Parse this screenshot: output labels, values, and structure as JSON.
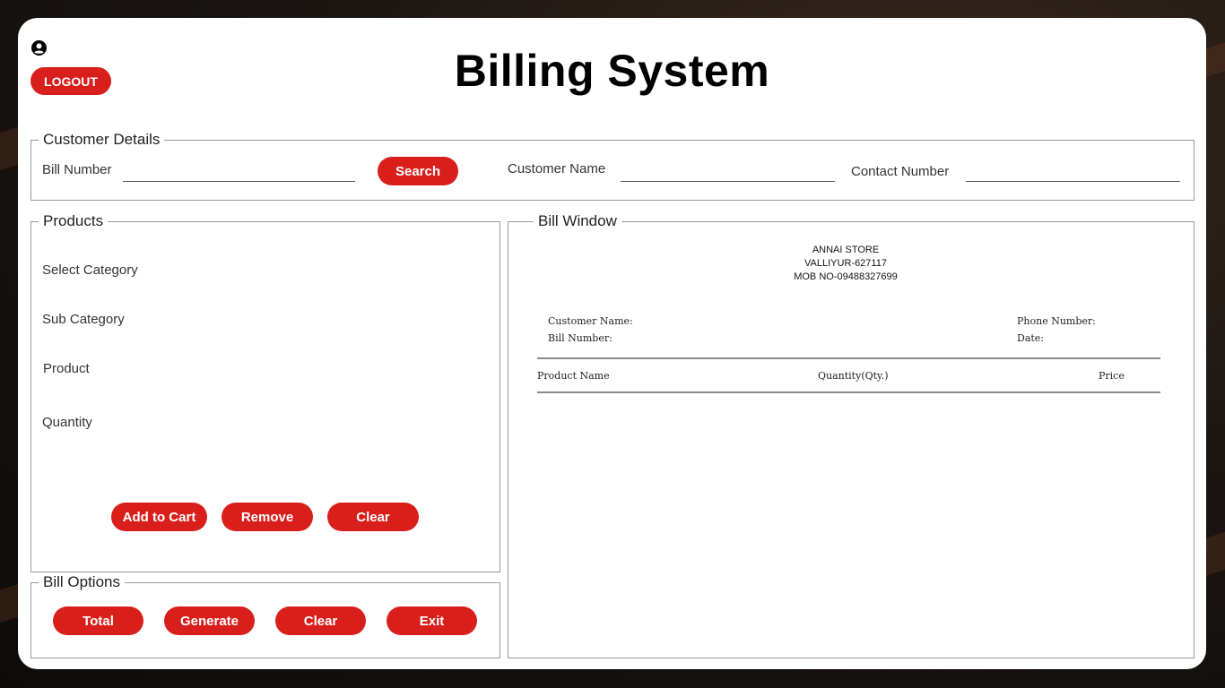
{
  "header": {
    "logout_label": "LOGOUT",
    "title": "Billing System"
  },
  "customer_details": {
    "legend": "Customer Details",
    "bill_number_label": "Bill Number",
    "bill_number_value": "",
    "search_label": "Search",
    "customer_name_label": "Customer Name",
    "customer_name_value": "",
    "contact_number_label": "Contact Number",
    "contact_number_value": ""
  },
  "products": {
    "legend": "Products",
    "select_category_label": "Select Category",
    "sub_category_label": "Sub Category",
    "product_label": "Product",
    "quantity_label": "Quantity",
    "add_to_cart_label": "Add to Cart",
    "remove_label": "Remove",
    "clear_label": "Clear"
  },
  "bill_options": {
    "legend": "Bill Options",
    "total_label": "Total",
    "generate_label": "Generate",
    "clear_label": "Clear",
    "exit_label": "Exit"
  },
  "bill_window": {
    "legend": "Bill Window",
    "store_name": "ANNAI STORE",
    "store_address": "VALLIYUR-627117",
    "store_phone": "MOB NO-09488327699",
    "customer_name_label": "Customer Name:",
    "bill_number_label": "Bill Number:",
    "phone_number_label": "Phone Number:",
    "date_label": "Date:",
    "col_product": "Product Name",
    "col_quantity": "Quantity(Qty.)",
    "col_price": "Price"
  },
  "colors": {
    "accent": "#d91f1b",
    "card": "#ffffff"
  },
  "icons": {
    "user": "user-circle-icon"
  }
}
